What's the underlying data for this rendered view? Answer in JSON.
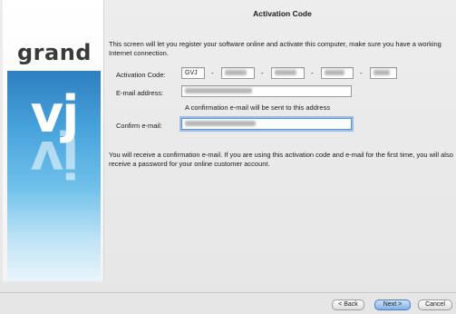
{
  "window": {
    "title": "Activation Code"
  },
  "brand": {
    "word": "grand",
    "glyph": "vj"
  },
  "intro_text": "This screen will let you register your software online and activate this computer, make sure you have a working Internet connection.",
  "form": {
    "activation_label": "Activation Code:",
    "activation_prefix": "GVJ",
    "activation_separator": "-",
    "email_label": "E-mail address:",
    "confirm_note": "A confirmation e-mail will be sent to this address",
    "confirm_label": "Confirm e-mail:"
  },
  "footer_text": "You will receive a confirmation e-mail. If you are using this activation code and e-mail for the first time, you will also receive a password for your online customer account.",
  "buttons": {
    "back": "< Back",
    "next": "Next >",
    "cancel": "Cancel"
  },
  "icons": {
    "brand_logo": "grandvj-logo"
  }
}
